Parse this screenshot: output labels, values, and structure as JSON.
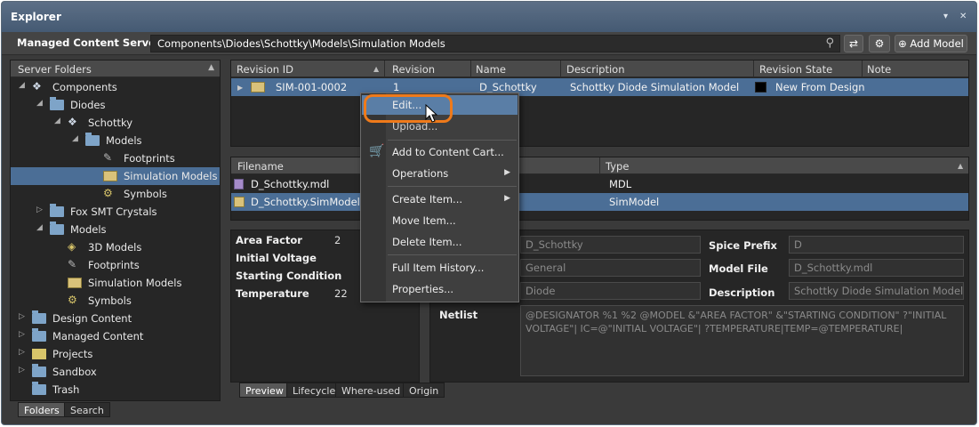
{
  "window": {
    "title": "Explorer",
    "pin_glyph": "▾",
    "close_glyph": "✕"
  },
  "toolbar": {
    "server_label": "Managed Content Server ▾",
    "path": "Components\\Diodes\\Schottky\\Models\\Simulation Models",
    "search_glyph": "⚲",
    "refresh_glyph": "⇄",
    "settings_glyph": "⚙",
    "add_model_label": "Add Model",
    "add_model_glyph": "⊕"
  },
  "left_panel": {
    "header": "Server Folders",
    "tree": [
      {
        "label": "Components",
        "icon": "components-icon"
      },
      {
        "label": "Diodes",
        "icon": "folder-icon"
      },
      {
        "label": "Schottky",
        "icon": "component-icon"
      },
      {
        "label": "Models",
        "icon": "folder-icon"
      },
      {
        "label": "Footprints",
        "icon": "footprint-icon"
      },
      {
        "label": "Simulation Models",
        "icon": "sim-model-icon"
      },
      {
        "label": "Symbols",
        "icon": "symbol-icon"
      },
      {
        "label": "Fox SMT Crystals",
        "icon": "folder-icon"
      },
      {
        "label": "Models",
        "icon": "folder-icon"
      },
      {
        "label": "3D Models",
        "icon": "3d-model-icon"
      },
      {
        "label": "Footprints",
        "icon": "footprint-icon"
      },
      {
        "label": "Simulation Models",
        "icon": "sim-model-icon"
      },
      {
        "label": "Symbols",
        "icon": "symbol-icon"
      },
      {
        "label": "Design Content",
        "icon": "folder-icon"
      },
      {
        "label": "Managed Content",
        "icon": "folder-icon"
      },
      {
        "label": "Projects",
        "icon": "projects-icon"
      },
      {
        "label": "Sandbox",
        "icon": "folder-icon"
      },
      {
        "label": "Trash",
        "icon": "folder-icon"
      }
    ],
    "tabs": [
      "Folders",
      "Search"
    ]
  },
  "revisions": {
    "columns": [
      "Revision ID",
      "Revision",
      "Name",
      "Description",
      "Revision State",
      "Note"
    ],
    "rows": [
      {
        "id": "SIM-001-0002",
        "revision": "1",
        "name": "D_Schottky",
        "description": "Schottky Diode Simulation Model",
        "state": "New From Design",
        "state_color": "#000000"
      }
    ]
  },
  "files": {
    "columns": [
      "Filename",
      "Type"
    ],
    "rows": [
      {
        "filename": "D_Schottky.mdl",
        "type": "MDL"
      },
      {
        "filename": "D_Schottky.SimModel",
        "type": "SimModel"
      }
    ]
  },
  "params": [
    {
      "label": "Area Factor",
      "value": "2"
    },
    {
      "label": "Initial Voltage",
      "value": ""
    },
    {
      "label": "Starting Condition",
      "value": ""
    },
    {
      "label": "Temperature",
      "value": "22"
    }
  ],
  "properties": {
    "name_value": "D_Schottky",
    "kind_value": "General",
    "model_type_value": "Diode",
    "spice_prefix_label": "Spice Prefix",
    "spice_prefix_value": "D",
    "model_file_label": "Model File",
    "model_file_value": "D_Schottky.mdl",
    "description_label": "Description",
    "description_value": "Schottky Diode Simulation Model",
    "netlist_label": "Netlist",
    "netlist_value": "@DESIGNATOR %1 %2 @MODEL &\"AREA FACTOR\" &\"STARTING CONDITION\" ?\"INITIAL VOLTAGE\"| IC=@\"INITIAL VOLTAGE\"| ?TEMPERATURE|TEMP=@TEMPERATURE|"
  },
  "detail_tabs": [
    "Preview",
    "Lifecycle",
    "Where-used",
    "Origin"
  ],
  "context_menu": {
    "items": [
      "Edit...",
      "Upload...",
      "Add to Content Cart...",
      "Operations",
      "Create Item...",
      "Move Item...",
      "Delete Item...",
      "Full Item History...",
      "Properties..."
    ],
    "accent": "#ef7a1a"
  }
}
